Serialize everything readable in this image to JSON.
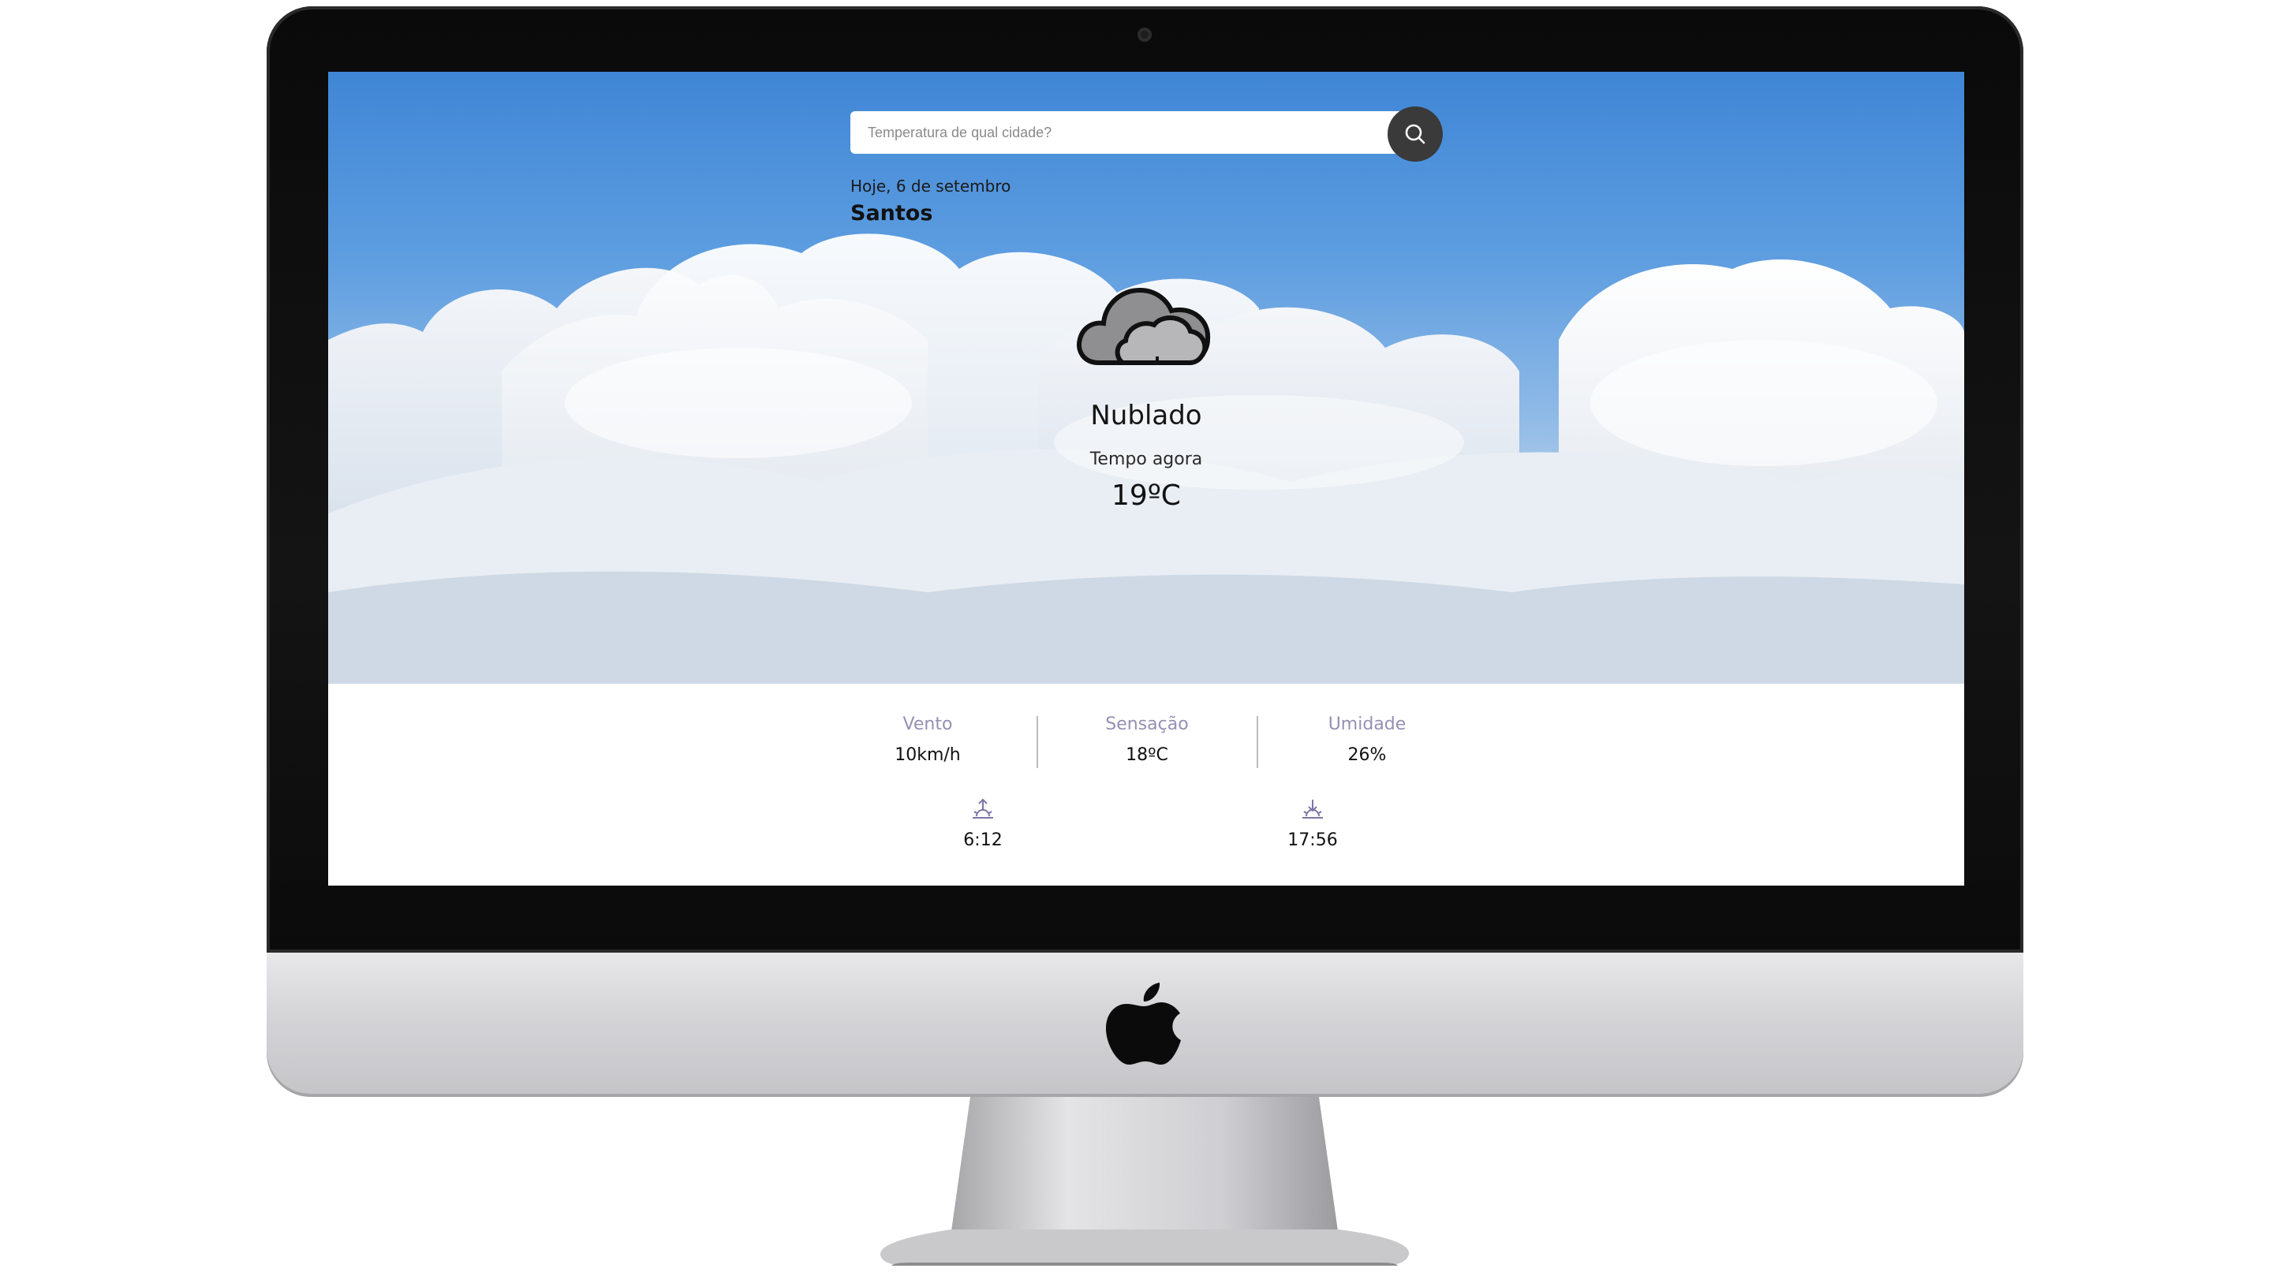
{
  "search": {
    "placeholder": "Temperatura de qual cidade?",
    "button_icon": "search-icon"
  },
  "header": {
    "date": "Hoje, 6 de setembro",
    "city": "Santos"
  },
  "current": {
    "icon": "cloud-icon",
    "condition": "Nublado",
    "label": "Tempo agora",
    "temperature": "19ºC"
  },
  "details": [
    {
      "label": "Vento",
      "value": "10km/h"
    },
    {
      "label": "Sensação",
      "value": "18ºC"
    },
    {
      "label": "Umidade",
      "value": "26%"
    }
  ],
  "sun": {
    "sunrise": {
      "icon": "sunrise-icon",
      "time": "6:12"
    },
    "sunset": {
      "icon": "sunset-icon",
      "time": "17:56"
    }
  },
  "colors": {
    "accent_dark": "#3a3a3a",
    "label_muted": "#9590b3",
    "sky": "#3f86d6"
  }
}
